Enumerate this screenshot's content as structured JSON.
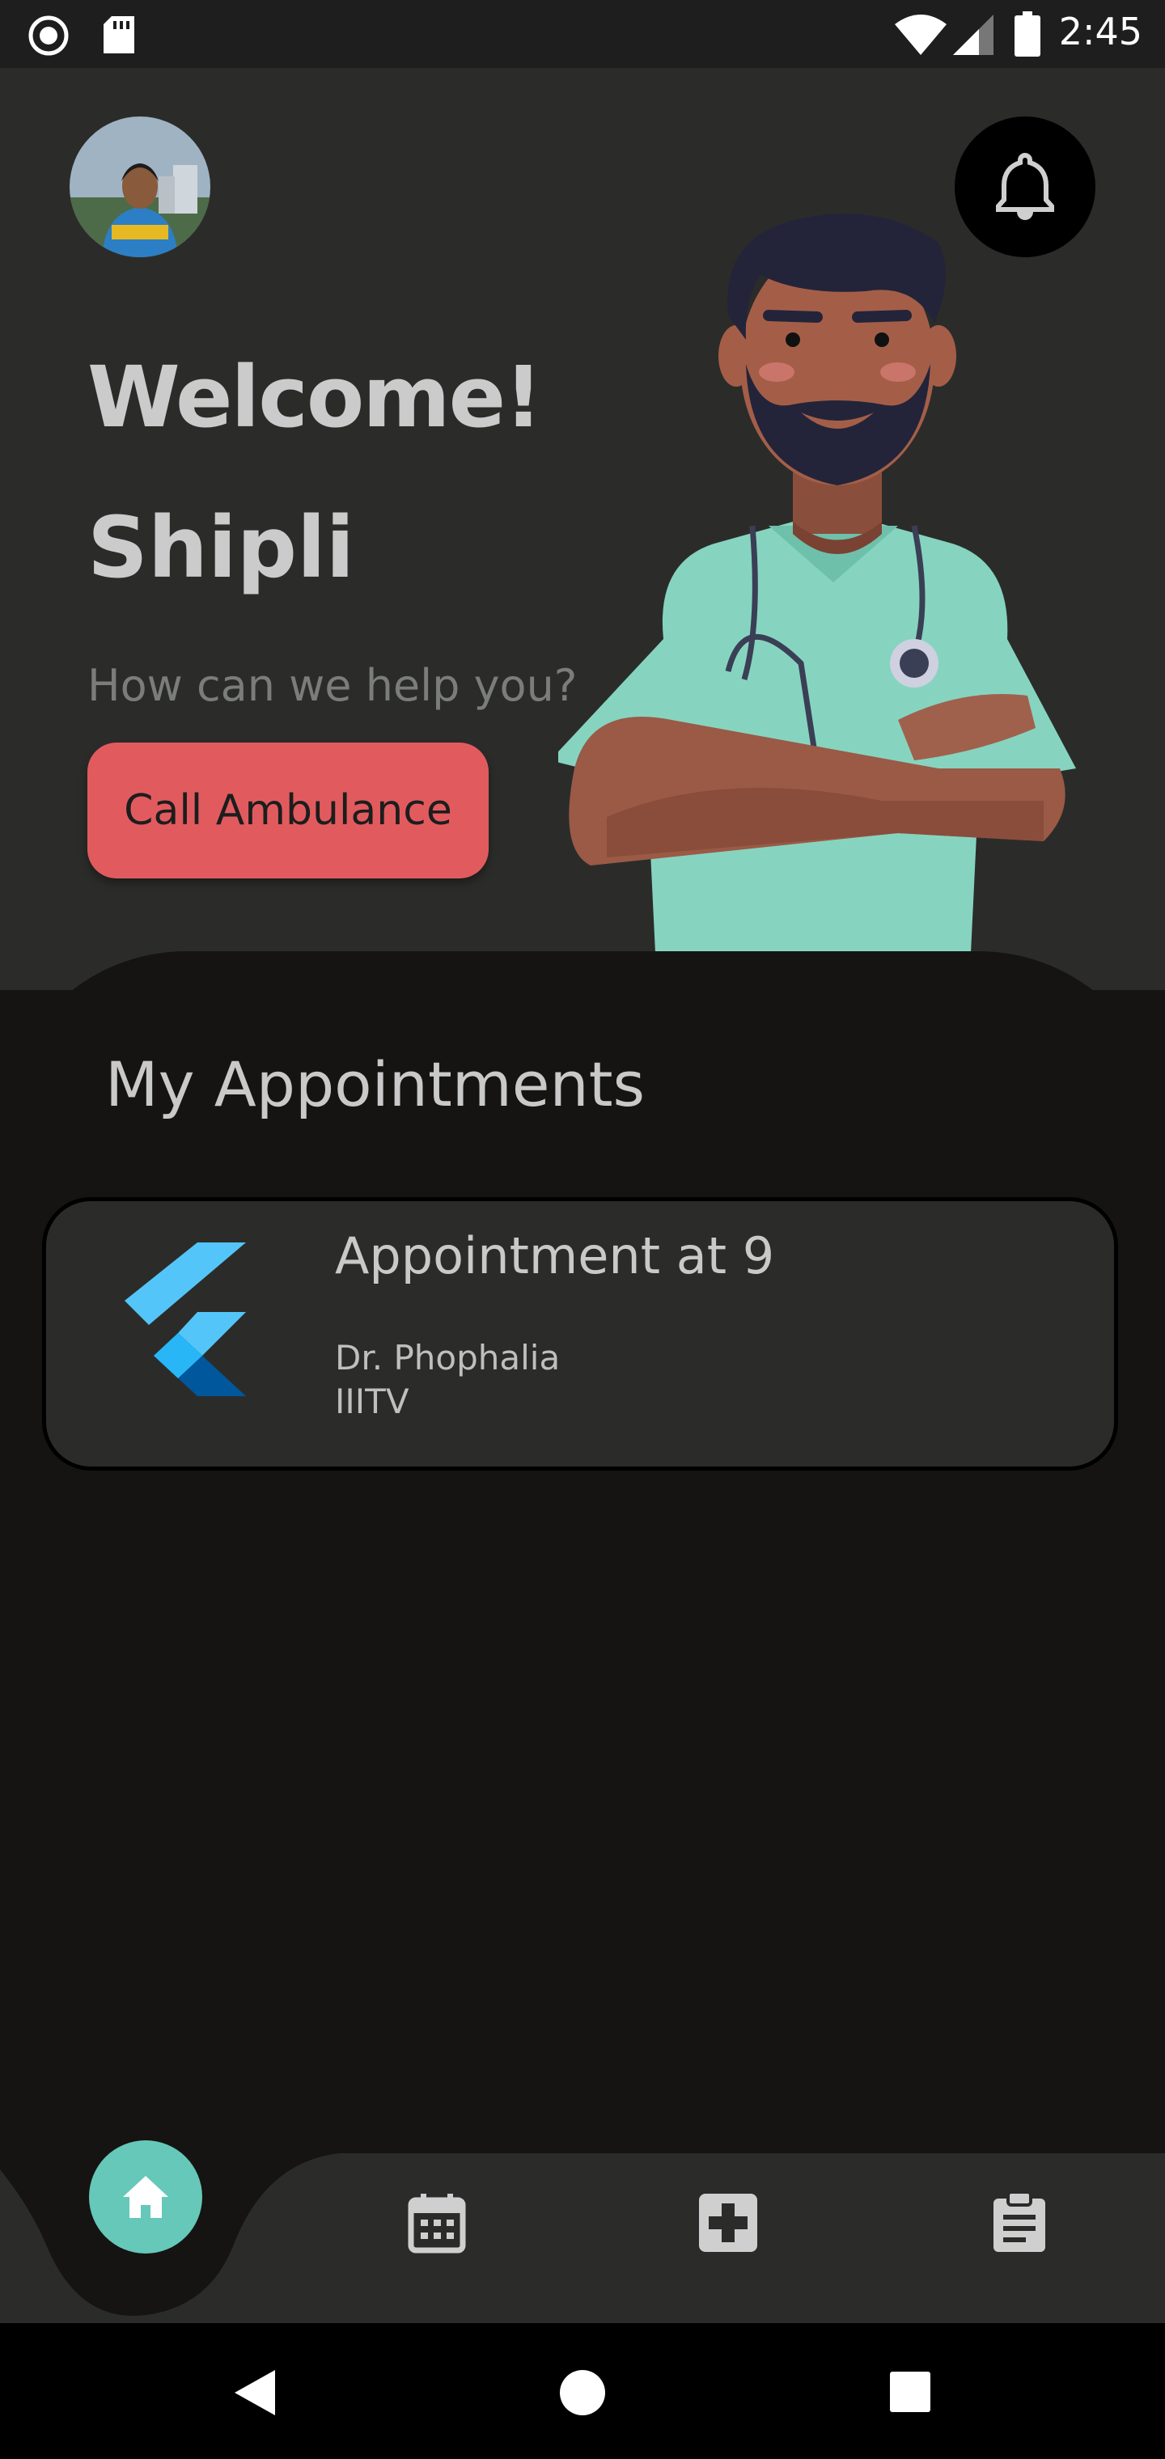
{
  "status_bar": {
    "time": "2:45"
  },
  "hero": {
    "welcome": "Welcome!",
    "user_name": "Shipli",
    "prompt": "How can we help you?",
    "ambulance_button": "Call Ambulance"
  },
  "appointments": {
    "title": "My Appointments",
    "items": [
      {
        "title": "Appointment at 9",
        "doctor": "Dr. Phophalia",
        "location": "IIITV"
      }
    ]
  },
  "bottom_nav": {
    "items": [
      {
        "icon": "home-icon",
        "active": true
      },
      {
        "icon": "calendar-icon",
        "active": false
      },
      {
        "icon": "medical-cross-icon",
        "active": false
      },
      {
        "icon": "clipboard-icon",
        "active": false
      }
    ]
  },
  "colors": {
    "background": "#151413",
    "surface": "#2b2c2a",
    "ambulance": "#e15b5e",
    "accent": "#66c8b8"
  }
}
